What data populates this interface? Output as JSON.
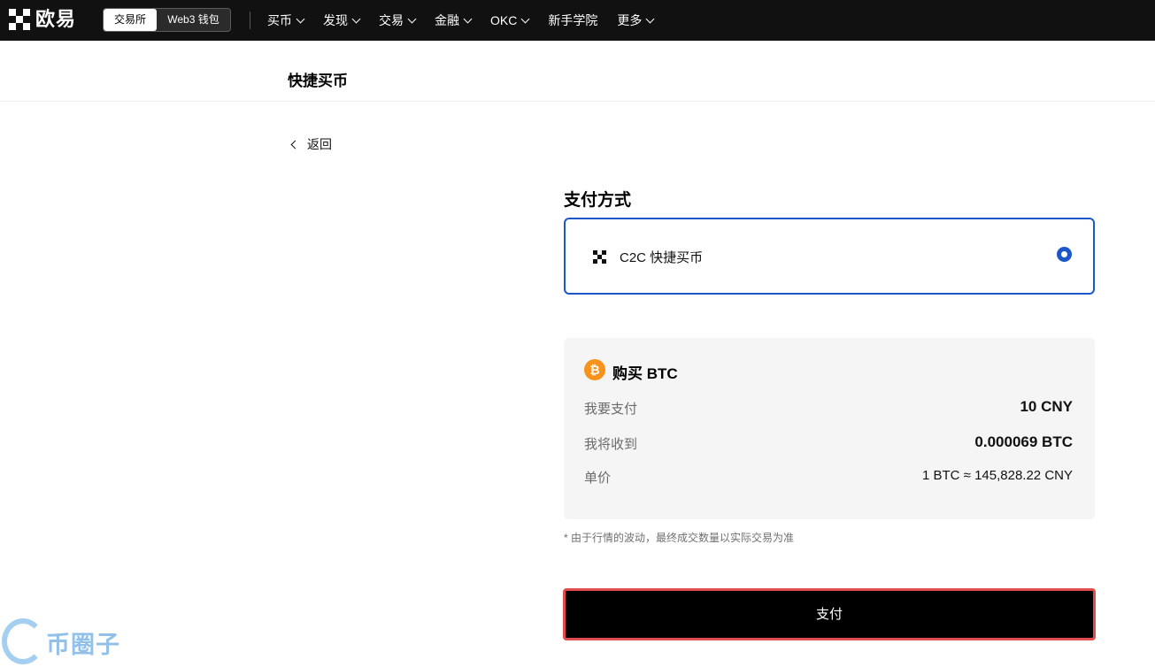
{
  "topbar": {
    "logo_text": "欧易",
    "mode_tabs": [
      "交易所",
      "Web3 钱包"
    ],
    "nav": [
      {
        "label": "买币"
      },
      {
        "label": "发现"
      },
      {
        "label": "交易"
      },
      {
        "label": "金融"
      },
      {
        "label": "OKC"
      },
      {
        "label": "新手学院"
      },
      {
        "label": "更多"
      }
    ]
  },
  "page": {
    "title": "快捷买币",
    "back_label": "返回"
  },
  "payment": {
    "section_title": "支付方式",
    "option_label": "C2C 快捷买币",
    "selected": true
  },
  "summary": {
    "title": "购买 BTC",
    "coin_icon": "bitcoin-icon",
    "rows": [
      {
        "label": "我要支付",
        "value": "10 CNY"
      },
      {
        "label": "我将收到",
        "value": "0.000069 BTC"
      },
      {
        "label": "单价",
        "value": "1 BTC ≈ 145,828.22 CNY"
      }
    ]
  },
  "note": "* 由于行情的波动，最终成交数量以实际交易为准",
  "pay_button": "支付",
  "watermark": "币圈子",
  "colors": {
    "topbar": "#111111",
    "accent_blue": "#1b57c9",
    "btc_orange": "#f7931a",
    "button_highlight": "#e24c4c"
  }
}
